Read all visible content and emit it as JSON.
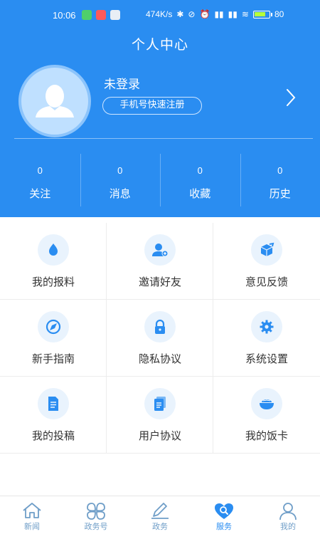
{
  "status_bar": {
    "time": "10:06",
    "network_speed": "474K/s",
    "battery": "80"
  },
  "header": {
    "title": "个人中心"
  },
  "profile": {
    "login_status": "未登录",
    "register_button": "手机号快速注册"
  },
  "stats": [
    {
      "value": "0",
      "label": "关注"
    },
    {
      "value": "0",
      "label": "消息"
    },
    {
      "value": "0",
      "label": "收藏"
    },
    {
      "value": "0",
      "label": "历史"
    }
  ],
  "menu": [
    {
      "label": "我的报料",
      "icon": "drop-icon"
    },
    {
      "label": "邀请好友",
      "icon": "add-user-icon"
    },
    {
      "label": "意见反馈",
      "icon": "feedback-box-icon"
    },
    {
      "label": "新手指南",
      "icon": "compass-icon"
    },
    {
      "label": "隐私协议",
      "icon": "lock-icon"
    },
    {
      "label": "系统设置",
      "icon": "gear-icon"
    },
    {
      "label": "我的投稿",
      "icon": "document-icon"
    },
    {
      "label": "用户协议",
      "icon": "agreement-icon"
    },
    {
      "label": "我的饭卡",
      "icon": "rice-bowl-icon"
    }
  ],
  "tabbar": [
    {
      "label": "新闻",
      "icon": "home-icon"
    },
    {
      "label": "政务号",
      "icon": "clover-icon"
    },
    {
      "label": "政务",
      "icon": "pen-icon"
    },
    {
      "label": "服务",
      "icon": "heart-search-icon"
    },
    {
      "label": "我的",
      "icon": "person-icon"
    }
  ],
  "colors": {
    "primary": "#2a8df1",
    "icon_bg": "#e9f3fd",
    "tab_inactive": "#6f9ec8"
  }
}
